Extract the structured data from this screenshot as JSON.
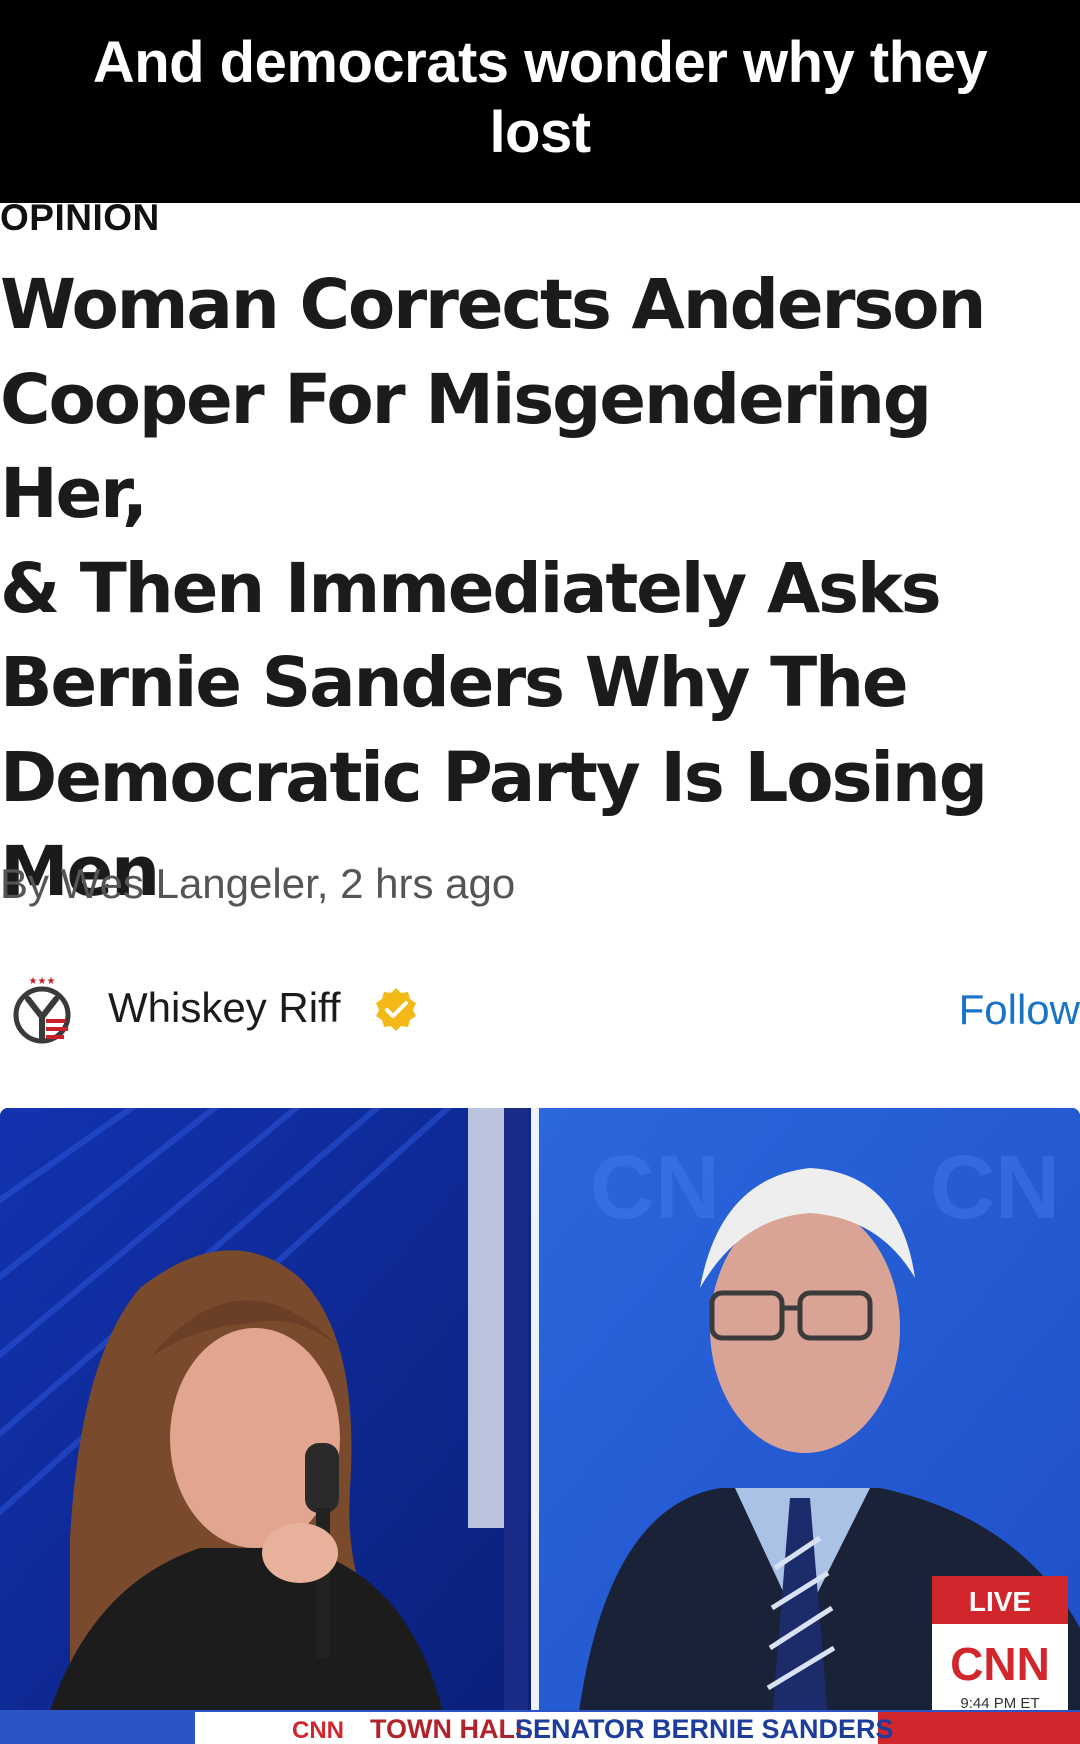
{
  "caption": {
    "text": "And democrats wonder why they lost"
  },
  "article": {
    "section_label": "OPINION",
    "headline_lines": [
      "Woman Corrects Anderson",
      "Cooper For Misgendering Her,",
      "& Then Immediately Asks",
      "Bernie Sanders Why The",
      "Democratic Party Is Losing",
      "Men"
    ],
    "byline": "By Wes Langeler, 2 hrs ago"
  },
  "source": {
    "name": "Whiskey Riff",
    "follow_label": "Follow",
    "logo_icon": "whiskey-riff-logo",
    "verified_icon": "verified-check-icon"
  },
  "video": {
    "live_label": "LIVE",
    "network": "CNN",
    "time": "9:44 PM ET",
    "ticker_network": "CNN",
    "ticker_program": "TOWN HALL",
    "ticker_subject": "SENATOR BERNIE SANDERS",
    "colors": {
      "studio_blue": "#1f4fc9",
      "live_red": "#d0262c",
      "ticker_blue": "#1d3d9c"
    }
  }
}
